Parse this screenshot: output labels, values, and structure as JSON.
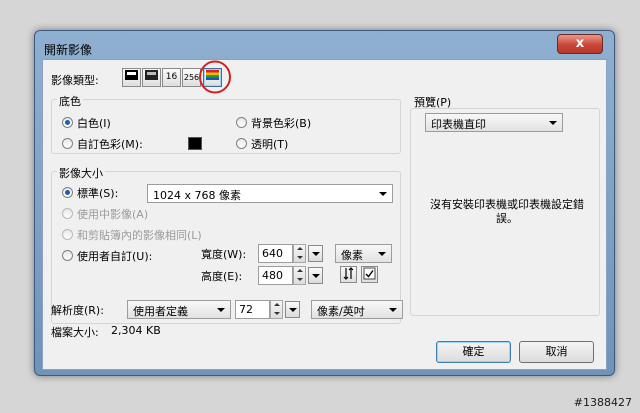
{
  "window": {
    "title": "開新影像",
    "close_glyph": "x"
  },
  "image_type": {
    "label": "影像類型:",
    "buttons": [
      {
        "name": "type-bw",
        "text": ""
      },
      {
        "name": "type-gray",
        "text": ""
      },
      {
        "name": "type-16",
        "text": "16"
      },
      {
        "name": "type-256",
        "text": "256"
      },
      {
        "name": "type-24bit",
        "text": ""
      }
    ],
    "selected": "type-24bit"
  },
  "background": {
    "group_label": "底色",
    "white": "白色(I)",
    "bg_color": "背景色彩(B)",
    "custom": "自訂色彩(M):",
    "custom_swatch_color": "#000000",
    "transparent": "透明(T)",
    "selected": "white"
  },
  "image_size": {
    "group_label": "影像大小",
    "standard": "標準(S):",
    "standard_value": "1024 x 768 像素",
    "use_image": "使用中影像(A)",
    "clipboard": "和剪貼簿內的影像相同(L)",
    "user_defined": "使用者自訂(U):",
    "width_label": "寬度(W):",
    "width_value": "640",
    "height_label": "高度(E):",
    "height_value": "480",
    "unit": "像素",
    "selected": "standard"
  },
  "resolution": {
    "label": "解析度(R):",
    "preset": "使用者定義",
    "value": "72",
    "unit": "像素/英吋"
  },
  "file_size": {
    "label": "檔案大小:",
    "value": "2,304 KB"
  },
  "preview": {
    "label": "預覽(P)",
    "selection": "印表機直印",
    "message": "沒有安裝印表機或印表機設定錯誤。"
  },
  "buttons": {
    "ok": "確定",
    "cancel": "取消"
  },
  "watermark": "#1388427",
  "colors": {
    "highlight_circle": "#d42020",
    "accent": "#1c5fb0"
  }
}
